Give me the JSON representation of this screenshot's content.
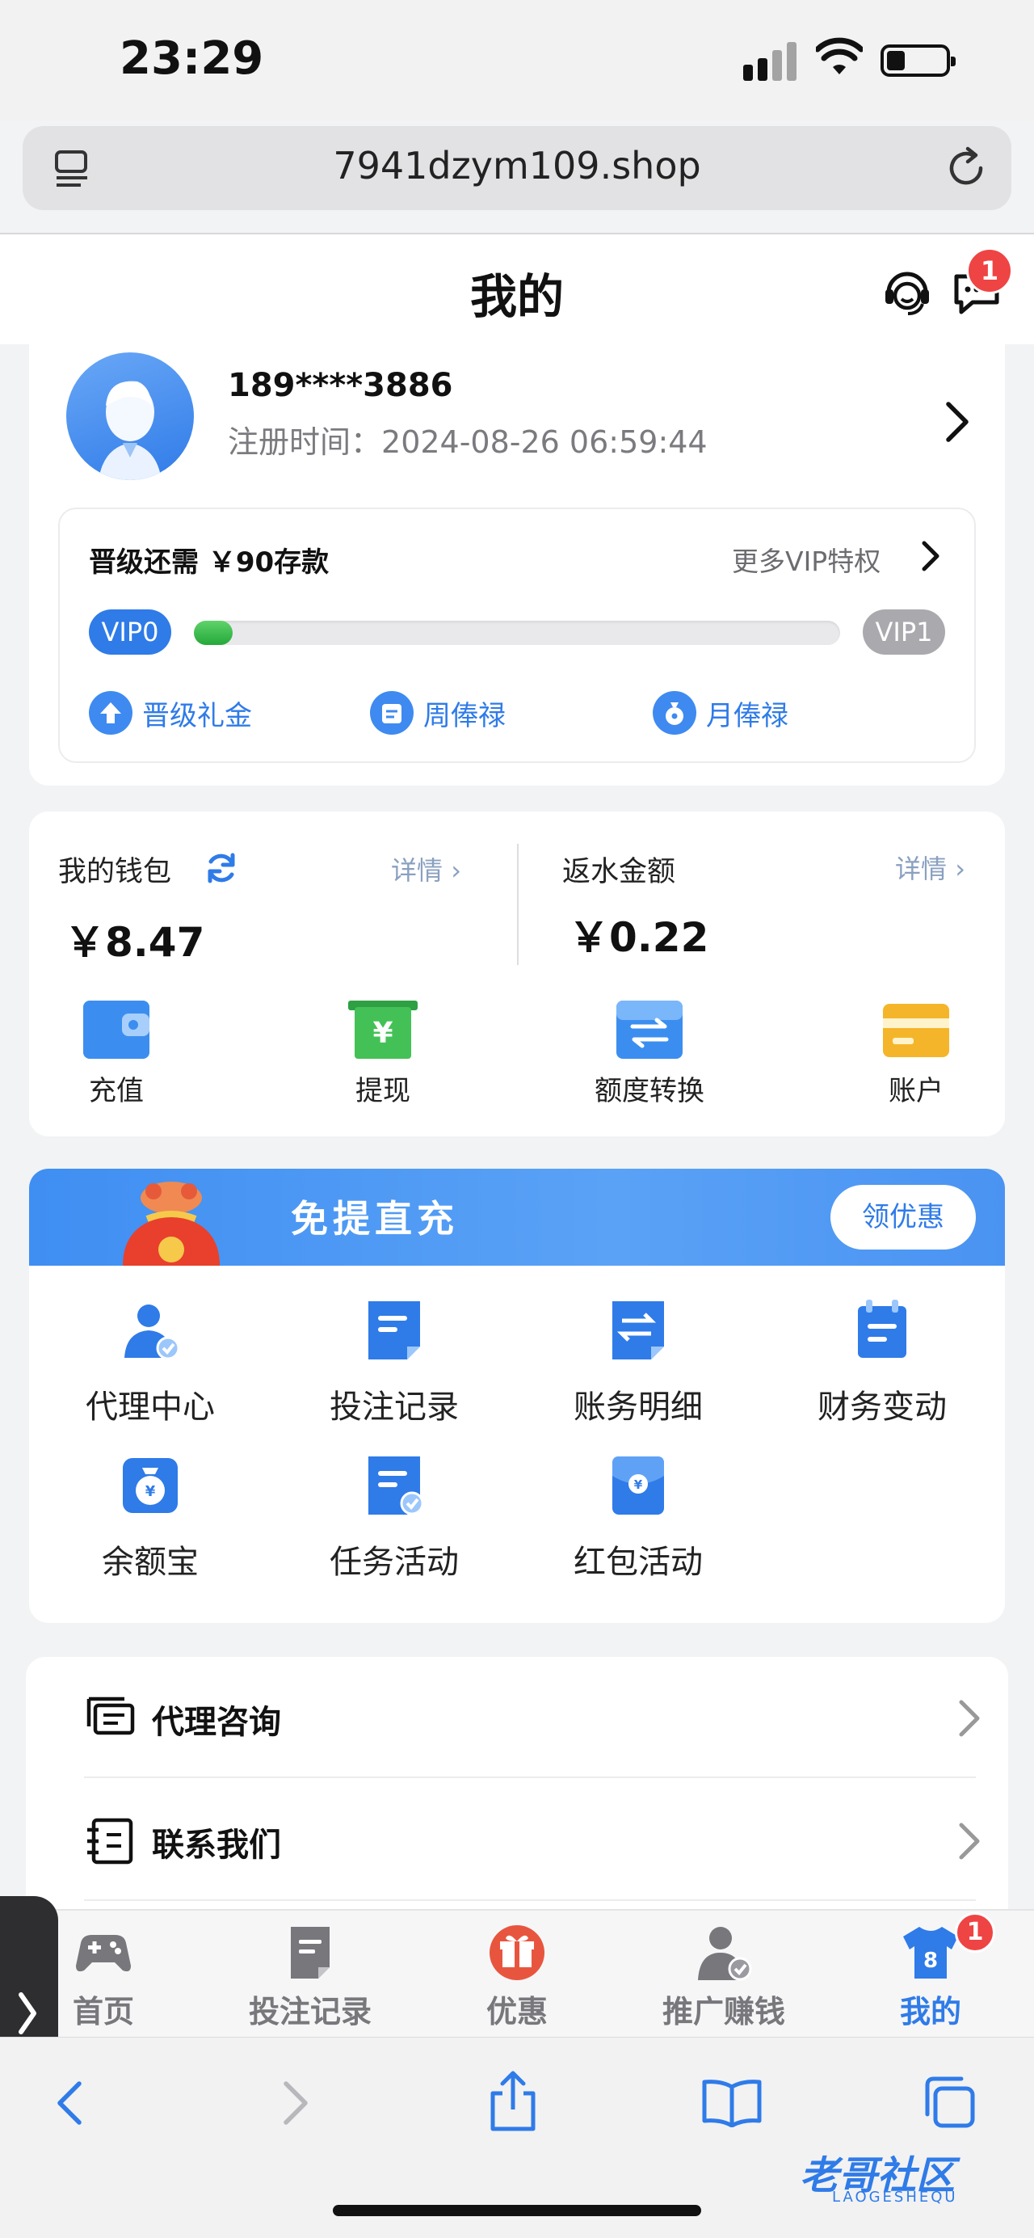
{
  "status_bar": {
    "time": "23:29"
  },
  "browser": {
    "url": "7941dzym109.shop"
  },
  "header": {
    "title": "我的",
    "message_badge": "1"
  },
  "profile": {
    "phone": "189****3886",
    "register_label": "注册时间：",
    "register_time": "2024-08-26 06:59:44",
    "vip": {
      "needs_text": "晋级还需 ￥90存款",
      "more_vip": "更多VIP特权",
      "current_level": "VIP0",
      "next_level": "VIP1",
      "progress_fraction": 0.06,
      "perks": [
        "晋级礼金",
        "周俸禄",
        "月俸禄"
      ]
    }
  },
  "wallet": {
    "my_wallet_label": "我的钱包",
    "detail_label": "详情",
    "balance": "￥8.47",
    "rebate_label": "返水金额",
    "rebate_amount": "￥0.22",
    "actions": [
      "充值",
      "提现",
      "额度转换",
      "账户"
    ]
  },
  "banner": {
    "text": "免提直充",
    "button": "领优惠"
  },
  "grid": {
    "items": [
      "代理中心",
      "投注记录",
      "账务明细",
      "财务变动",
      "余额宝",
      "任务活动",
      "红包活动"
    ]
  },
  "list": {
    "items": [
      "代理咨询",
      "联系我们"
    ]
  },
  "tabbar": {
    "tabs": [
      "首页",
      "投注记录",
      "优惠",
      "推广赚钱",
      "我的"
    ],
    "active": "我的",
    "badge": "1"
  },
  "watermark": {
    "text": "老哥社区",
    "sub": "LAOGESHEQU"
  },
  "colors": {
    "accent": "#2f7be8",
    "badge": "#ef4444",
    "progress": "#24a83a"
  }
}
